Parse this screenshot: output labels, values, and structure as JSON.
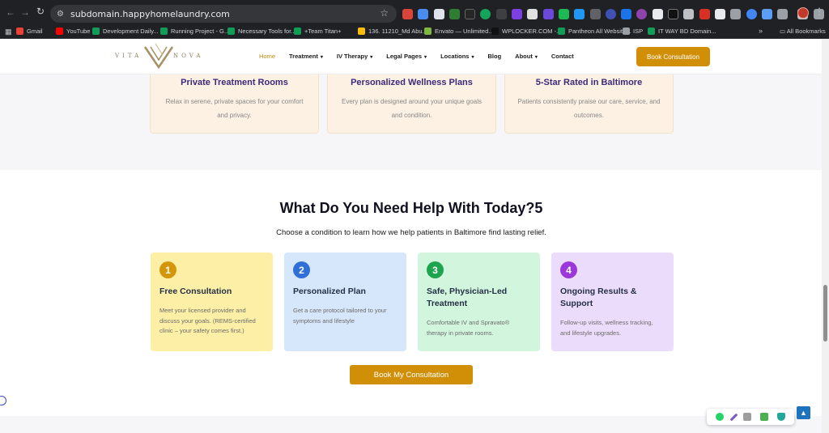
{
  "browser": {
    "url": "subdomain.happyhomelaundry.com",
    "bookmarks": [
      {
        "label": "Gmail",
        "color": "#ea4335"
      },
      {
        "label": "YouTube",
        "color": "#ff0000"
      },
      {
        "label": "Development Daily...",
        "color": "#0f9d58"
      },
      {
        "label": "Running Project - G...",
        "color": "#0f9d58"
      },
      {
        "label": "Necessary Tools for...",
        "color": "#0f9d58"
      },
      {
        "label": "+Team Titan+",
        "color": "#0f9d58"
      },
      {
        "label": "136. 11210_Md Abu...",
        "color": "#fbbc04"
      },
      {
        "label": "Envato — Unlimited...",
        "color": "#82b541"
      },
      {
        "label": "WPLOCKER.COM -...",
        "color": "#111111"
      },
      {
        "label": "Pantheon All Website...",
        "color": "#0f9d58"
      },
      {
        "label": "ISP",
        "color": "#9aa0a6"
      },
      {
        "label": "IT WAY BD Domain...",
        "color": "#0f9d58"
      }
    ],
    "all_bookmarks": "All Bookmarks"
  },
  "header": {
    "logo_left": "VITA",
    "logo_right": "NOVA",
    "menu": [
      {
        "label": "Home",
        "dropdown": false,
        "current": true
      },
      {
        "label": "Treatment",
        "dropdown": true,
        "current": false
      },
      {
        "label": "IV Therapy",
        "dropdown": true,
        "current": false
      },
      {
        "label": "Legal Pages",
        "dropdown": true,
        "current": false
      },
      {
        "label": "Locations",
        "dropdown": true,
        "current": false
      },
      {
        "label": "Blog",
        "dropdown": false,
        "current": false
      },
      {
        "label": "About",
        "dropdown": true,
        "current": false
      },
      {
        "label": "Contact",
        "dropdown": false,
        "current": false
      }
    ],
    "cta": "Book Consultation"
  },
  "features": [
    {
      "title": "Private Treatment Rooms",
      "desc": "Relax in serene, private spaces for your comfort and privacy."
    },
    {
      "title": "Personalized Wellness Plans",
      "desc": "Every plan is designed around your unique goals and condition."
    },
    {
      "title": "5-Star Rated in Baltimore",
      "desc": "Patients consistently praise our care, service, and outcomes."
    }
  ],
  "help": {
    "title": "What Do You Need Help With Today?5",
    "subtitle": "Choose a condition to learn how we help patients in Baltimore find lasting relief.",
    "steps": [
      {
        "number": "1",
        "title": "Free Consultation",
        "desc": "Meet your licensed provider and discuss your goals. (REMS-certified clinic – your safety comes first.)",
        "bg": "#fdf0a6",
        "badge": "#d4960b"
      },
      {
        "number": "2",
        "title": "Personalized Plan",
        "desc": "Get a care protocol tailored to your symptoms and lifestyle",
        "bg": "#d6e6fb",
        "badge": "#2f6fd6"
      },
      {
        "number": "3",
        "title": "Safe, Physician-Led Treatment",
        "desc": "Comfortable IV and Spravato® therapy in private rooms.",
        "bg": "#d2f5dd",
        "badge": "#1ea34e"
      },
      {
        "number": "4",
        "title": "Ongoing Results & Support",
        "desc": "Follow-up visits, wellness tracking, and lifestyle upgrades.",
        "bg": "#ecdcfb",
        "badge": "#9a38d9"
      }
    ],
    "cta": "Book My Consultation"
  },
  "colors": {
    "accent": "#d18f07",
    "heading_purple": "#3c2a7c"
  }
}
